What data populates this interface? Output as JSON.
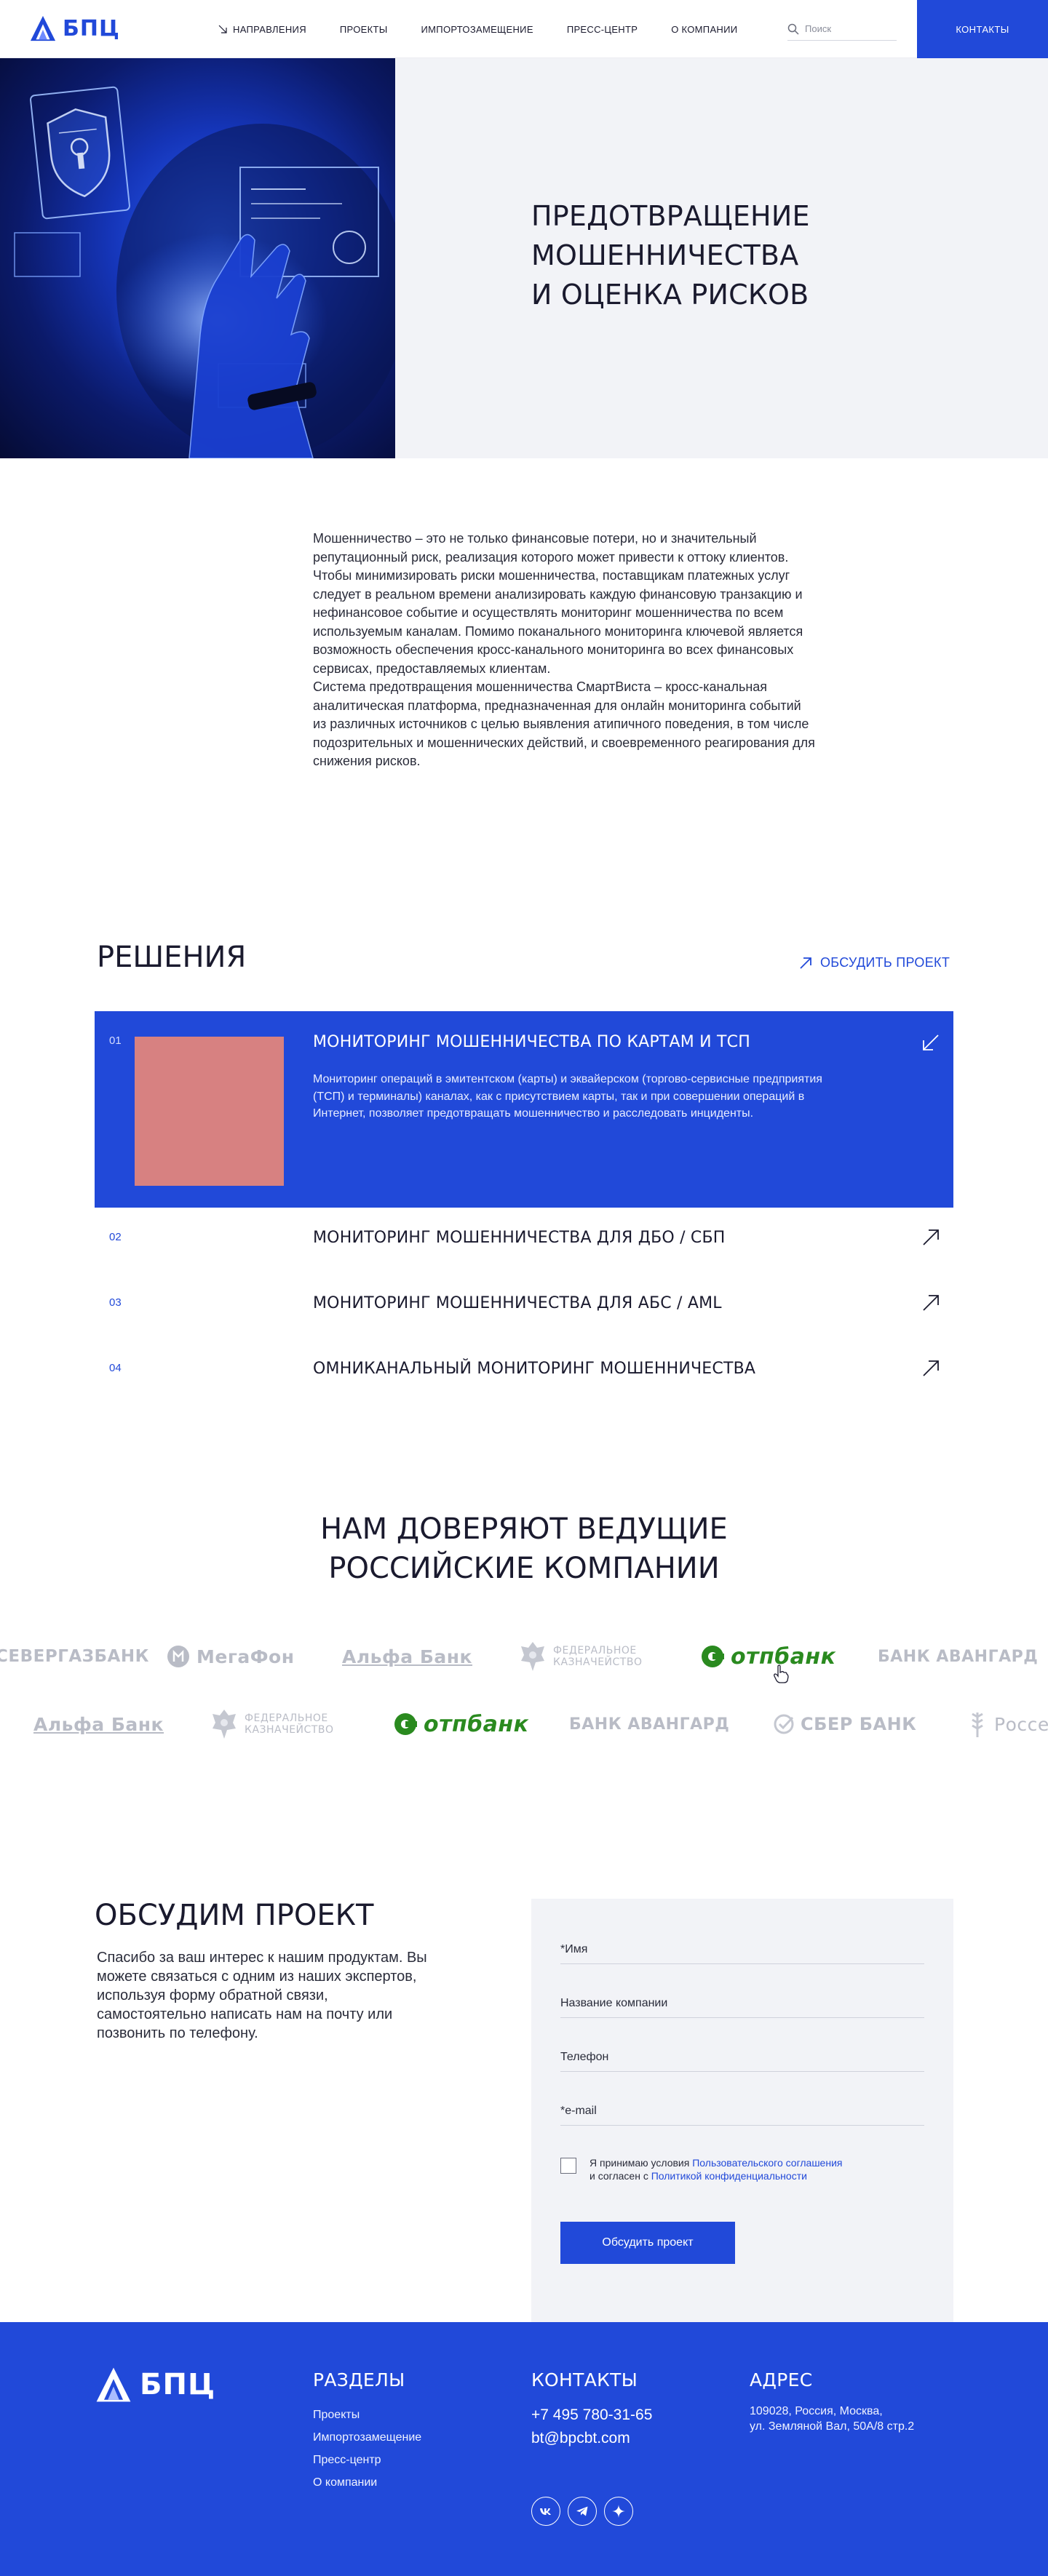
{
  "header": {
    "logo_text": "БПЦ",
    "nav": [
      "НАПРАВЛЕНИЯ",
      "ПРОЕКТЫ",
      "ИМПОРТОЗАМЕЩЕНИЕ",
      "ПРЕСС-ЦЕНТР",
      "О КОМПАНИИ"
    ],
    "search_placeholder": "Поиск",
    "contacts_label": "КОНТАКТЫ"
  },
  "hero": {
    "title_lines": [
      "ПРЕДОТВРАЩЕНИЕ",
      "МОШЕННИЧЕСТВА",
      "И ОЦЕНКА РИСКОВ"
    ]
  },
  "intro": {
    "p1": "Мошенничество – это не только финансовые потери, но и значительный репутационный риск, реализация которого может привести к оттоку клиентов. Чтобы минимизировать риски мошенничества, поставщикам платежных услуг следует в реальном времени анализировать каждую финансовую транзакцию и нефинансовое событие и осуществлять мониторинг мошенничества по всем используемым каналам. Помимо поканального мониторинга ключевой является возможность обеспечения кросс-канального мониторинга во всех финансовых сервисах, предоставляемых клиентам.",
    "p2": "Система предотвращения мошенничества СмартВиста – кросс-канальная аналитическая платформа, предназначенная для онлайн мониторинга событий из различных источников с целью выявления атипичного поведения, в том числе подозрительных и мошеннических действий, и своевременного реагирования для снижения рисков."
  },
  "solutions": {
    "title": "РЕШЕНИЯ",
    "discuss_label": "ОБСУДИТЬ ПРОЕКТ",
    "items": [
      {
        "num": "01",
        "name": "МОНИТОРИНГ МОШЕННИЧЕСТВА ПО КАРТАМ И ТСП",
        "desc": "Мониторинг операций в эмитентском (карты) и эквайерском (торгово-сервисные предприятия (ТСП) и терминалы) каналах, как с присутствием карты, так и при совершении операций в Интернет, позволяет предотвращать мошенничество и расследовать инциденты."
      },
      {
        "num": "02",
        "name": "МОНИТОРИНГ МОШЕННИЧЕСТВА ДЛЯ ДБО / СБП"
      },
      {
        "num": "03",
        "name": "МОНИТОРИНГ МОШЕННИЧЕСТВА ДЛЯ АБС / AML"
      },
      {
        "num": "04",
        "name": "ОМНИКАНАЛЬНЫЙ МОНИТОРИНГ МОШЕННИЧЕСТВА"
      }
    ]
  },
  "partners": {
    "title_lines": [
      "НАМ ДОВЕРЯЮТ ВЕДУЩИЕ",
      "РОССИЙСКИЕ КОМПАНИИ"
    ],
    "row1": [
      "СЕВЕРГАЗБАНК",
      "МегаФон",
      "Альфа Банк",
      "ФЕДЕРАЛЬНОЕ КАЗНАЧЕЙСТВО",
      "отпбанк",
      "БАНК АВАНГАРД"
    ],
    "row2": [
      "Альфа Банк",
      "ФЕДЕРАЛЬНОЕ КАЗНАЧЕЙСТВО",
      "отпбанк",
      "БАНК АВАНГАРД",
      "СБЕР БАНК",
      "Россе"
    ],
    "treasury_line1": "ФЕДЕРАЛЬНОЕ",
    "treasury_line2": "КАЗНАЧЕЙСТВО"
  },
  "form": {
    "title": "ОБСУДИМ ПРОЕКТ",
    "text": "Спасибо за ваш интерес к нашим продуктам. Вы можете связаться с одним из наших экспертов, используя форму обратной связи, самостоятельно написать нам на почту или позвонить по телефону.",
    "fields": [
      "*Имя",
      "Название компании",
      "Телефон",
      "*e-mail"
    ],
    "consent_prefix": "Я принимаю условия ",
    "consent_link1": "Пользовательского соглашения",
    "consent_mid": "и согласен с ",
    "consent_link2": "Политикой конфиденциальности",
    "submit_label": "Обсудить проект"
  },
  "footer": {
    "logo_text": "БПЦ",
    "sections_title": "РАЗДЕЛЫ",
    "sections": [
      "Проекты",
      "Импортозамещение",
      "Пресс-центр",
      "О компании"
    ],
    "contacts_title": "КОНТАКТЫ",
    "phone": "+7 495 780-31-65",
    "email": "bt@bpcbt.com",
    "address_title": "АДРЕС",
    "address_line1": "109028, Россия, Москва,",
    "address_line2": "ул. Земляной Вал, 50А/8 стр.2"
  },
  "colors": {
    "accent": "#2149d9",
    "panel": "#f2f3f7",
    "thumb": "#d78181",
    "otp_green": "#2a8a1f"
  }
}
